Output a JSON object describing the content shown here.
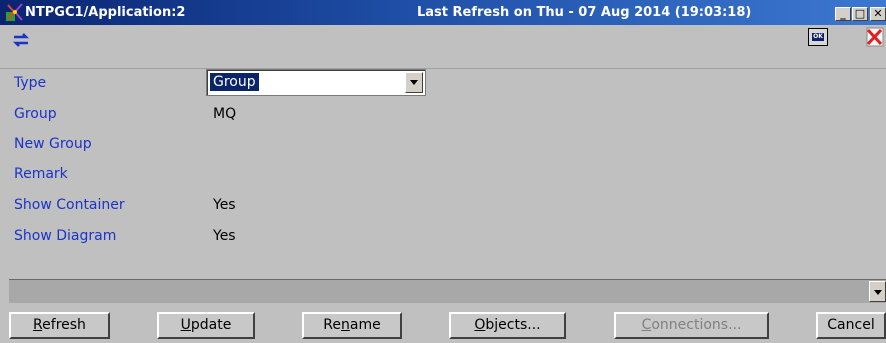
{
  "window": {
    "title": "NTPGC1/Application:2",
    "last_refresh": "Last Refresh on Thu - 07 Aug 2014 (19:03:18)",
    "controls": {
      "minimize_glyph": "_",
      "maximize_glyph": "□",
      "close_glyph": "✕"
    }
  },
  "toolbar": {
    "sync_icon": "sync-icon",
    "ok_icon_label": "OK",
    "close_icon": "close-icon"
  },
  "form": {
    "type_label": "Type",
    "type_value": "Group",
    "group_label": "Group",
    "group_value": "MQ",
    "new_group_label": "New Group",
    "remark_label": "Remark",
    "show_container_label": "Show Container",
    "show_container_value": "Yes",
    "show_diagram_label": "Show Diagram",
    "show_diagram_value": "Yes"
  },
  "buttons": {
    "refresh": {
      "mnemonic": "R",
      "rest": "efresh"
    },
    "update": {
      "mnemonic": "U",
      "rest": "pdate"
    },
    "rename_pre": "Re",
    "rename_mnemonic": "n",
    "rename_post": "ame",
    "objects": {
      "mnemonic": "O",
      "rest": "bjects..."
    },
    "connections": {
      "mnemonic": "C",
      "rest": "onnections..."
    },
    "cancel": "Cancel"
  },
  "colors": {
    "label_blue": "#1a34c8",
    "selection_bg": "#0a246a",
    "window_bg": "#c0c0c0",
    "disabled_text": "#808080"
  }
}
